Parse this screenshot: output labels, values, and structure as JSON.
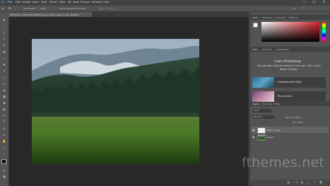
{
  "menubar": {
    "app_logo": "Ps",
    "items": [
      "File",
      "Edit",
      "Image",
      "Layer",
      "Type",
      "Select",
      "Filter",
      "3D",
      "View",
      "Plugins",
      "Window",
      "Help"
    ],
    "window_controls": [
      "—",
      "□",
      "✕"
    ]
  },
  "options_bar": {
    "home_icon": "home-icon",
    "auto_select": "Auto-Select:",
    "layer_select": "Layer",
    "show_transform": "Show Transform Controls"
  },
  "document_tab": {
    "title": "DSC06102 (MP-PHOTOGRAPH-pg @ 100% (Layer 0 copy, RGB/8) *"
  },
  "tools": [
    "move",
    "marquee",
    "lasso",
    "quick-select",
    "crop",
    "frame",
    "eyedropper",
    "healing",
    "brush",
    "clone-stamp",
    "history-brush",
    "eraser",
    "gradient",
    "blur",
    "dodge",
    "pen",
    "type",
    "path-select",
    "rectangle",
    "hand",
    "zoom",
    "more"
  ],
  "color_panel": {
    "tabs": [
      "Color",
      "Swatches",
      "Gradients",
      "Patterns"
    ],
    "hue_accent": "#d6212e"
  },
  "learn_panel": {
    "tabs": [
      "Learn",
      "Libraries",
      "Adjustments"
    ],
    "title": "Learn Photoshop",
    "description": "Step-by-step tutorials directly in the app. Pick a topic below to begin.",
    "cards": [
      {
        "label": "Fundamental Skills"
      },
      {
        "label": "Fix a photo"
      }
    ]
  },
  "layers_panel": {
    "tabs": [
      "Layers",
      "Channels",
      "Paths"
    ],
    "kind_filter": "Kind",
    "blend_mode": "Normal",
    "opacity_label": "Opacity: 100%",
    "fill_label": "Fill: 100%",
    "layers": [
      {
        "name": "Layer 0 copy"
      },
      {
        "name": "Layer 0"
      }
    ]
  },
  "watermark": {
    "text": "fthemes.net"
  },
  "colors": {
    "chrome": "#535353",
    "menubar": "#424242",
    "canvas_bg": "#282828",
    "panel_tab": "#424242"
  }
}
